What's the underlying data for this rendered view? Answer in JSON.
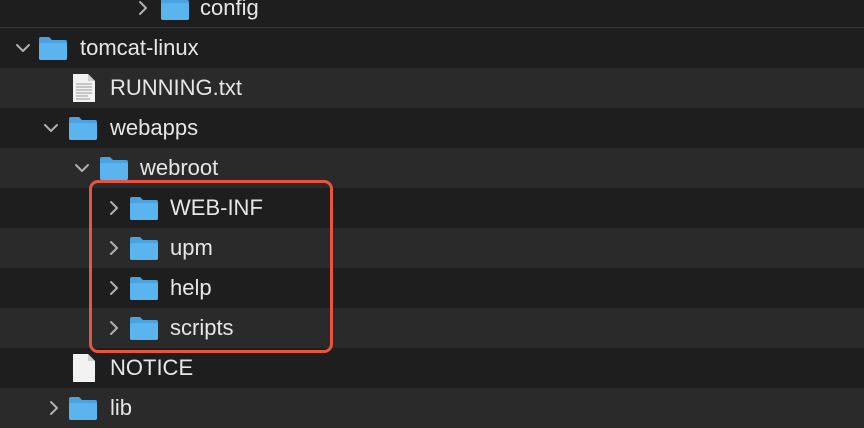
{
  "tree": {
    "rows": [
      {
        "label": "config",
        "icon": "folder-icon",
        "expanded": false
      },
      {
        "label": "tomcat-linux",
        "icon": "folder-icon",
        "expanded": true
      },
      {
        "label": "RUNNING.txt",
        "icon": "text-file-icon"
      },
      {
        "label": "webapps",
        "icon": "folder-icon",
        "expanded": true
      },
      {
        "label": "webroot",
        "icon": "folder-icon",
        "expanded": true
      },
      {
        "label": "WEB-INF",
        "icon": "folder-icon",
        "expanded": false
      },
      {
        "label": "upm",
        "icon": "folder-icon",
        "expanded": false
      },
      {
        "label": "help",
        "icon": "folder-icon",
        "expanded": false
      },
      {
        "label": "scripts",
        "icon": "folder-icon",
        "expanded": false
      },
      {
        "label": "NOTICE",
        "icon": "file-icon"
      },
      {
        "label": "lib",
        "icon": "folder-icon",
        "expanded": false
      }
    ]
  },
  "colors": {
    "highlight": "#e8553c",
    "folder": "#5ab4ee",
    "row_alt": "#2a2a2a",
    "background": "#1e1e1e"
  }
}
